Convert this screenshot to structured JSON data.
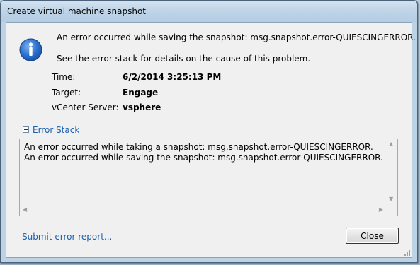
{
  "window": {
    "title": "Create virtual machine snapshot"
  },
  "message": {
    "line1": "An error occurred while saving the snapshot: msg.snapshot.error-QUIESCINGERROR.",
    "line2": "See the error stack for details on the cause of this problem."
  },
  "details": {
    "time_label": "Time:",
    "time_value": "6/2/2014 3:25:13 PM",
    "target_label": "Target:",
    "target_value": "Engage",
    "server_label": "vCenter Server:",
    "server_value": "vsphere"
  },
  "error_stack": {
    "label": "Error Stack",
    "lines": [
      "An error occurred while taking a snapshot: msg.snapshot.error-QUIESCINGERROR.",
      "An error occurred while saving the snapshot: msg.snapshot.error-QUIESCINGERROR."
    ]
  },
  "footer": {
    "submit_link": "Submit error report...",
    "close_label": "Close"
  },
  "icons": {
    "info": "info-icon"
  },
  "colors": {
    "link": "#1c5fab",
    "icon_blue": "#1f5fb8"
  }
}
